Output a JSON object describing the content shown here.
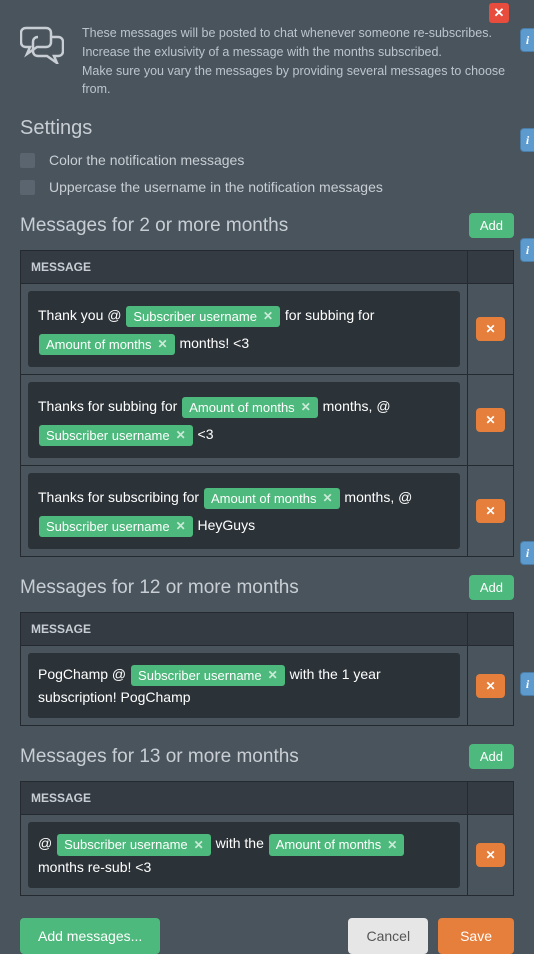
{
  "close_x": "✕",
  "info_i": "i",
  "header": {
    "line1": "These messages will be posted to chat whenever someone re-subscribes.",
    "line2": "Increase the exlusivity of a message with the months subscribed.",
    "line3": "Make sure you vary the messages by providing several messages to choose from."
  },
  "settings": {
    "title": "Settings",
    "opt_color": "Color the notification messages",
    "opt_uppercase": "Uppercase the username in the notification messages"
  },
  "col_header": "MESSAGE",
  "add_label": "Add",
  "pill_x": "✕",
  "del_x": "✕",
  "groups": {
    "g2": {
      "title": "Messages for 2 or more months",
      "rows": {
        "r0": {
          "p0": "Thank you @",
          "pill0": "Subscriber username",
          "p1": "for subbing for",
          "pill1": "Amount of months",
          "p2": "months! <3"
        },
        "r1": {
          "p0": "Thanks for subbing for",
          "pill0": "Amount of months",
          "p1": "months, @",
          "pill1": "Subscriber username",
          "p2": "<3"
        },
        "r2": {
          "p0": "Thanks for subscribing for",
          "pill0": "Amount of months",
          "p1": "months, @",
          "pill1": "Subscriber username",
          "p2": "HeyGuys"
        }
      }
    },
    "g12": {
      "title": "Messages for 12 or more months",
      "rows": {
        "r0": {
          "p0": "PogChamp @",
          "pill0": "Subscriber username",
          "p1": "with the 1 year subscription! PogChamp"
        }
      }
    },
    "g13": {
      "title": "Messages for 13 or more months",
      "rows": {
        "r0": {
          "p0": "@",
          "pill0": "Subscriber username",
          "p1": "with the",
          "pill1": "Amount of months",
          "p2": "months re-sub! <3"
        }
      }
    }
  },
  "footer": {
    "add_messages": "Add messages...",
    "cancel": "Cancel",
    "save": "Save"
  },
  "info_positions": [
    28,
    128,
    238,
    541,
    672
  ]
}
